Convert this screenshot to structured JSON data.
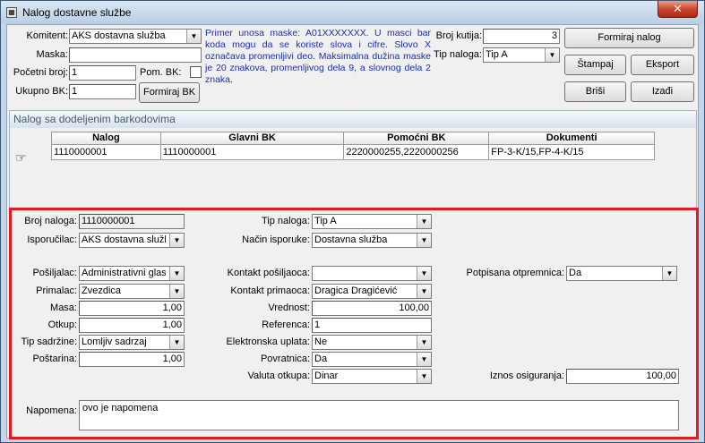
{
  "window": {
    "title": "Nalog dostavne službe",
    "close_glyph": "✕"
  },
  "header": {
    "komitent_label": "Komitent:",
    "komitent_value": "AKS dostavna služba",
    "maska_label": "Maska:",
    "maska_value": "",
    "pocetni_label": "Početni broj:",
    "pocetni_value": "1",
    "pom_bk_label": "Pom. BK:",
    "ukupno_label": "Ukupno BK:",
    "ukupno_value": "1",
    "formiraj_bk_label": "Formiraj BK",
    "mask_hint": "Primer unosa maske: A01XXXXXXX. U masci bar koda mogu da se koriste slova i cifre. Slovo X označava promenljivi deo. Maksimalna dužina maske je 20 znakova, promenljivog dela 9, a slovnog dela 2 znaka.",
    "broj_kutija_label": "Broj kutija:",
    "broj_kutija_value": "3",
    "tip_naloga_label": "Tip naloga:",
    "tip_naloga_value": "Tip A",
    "formiraj_nalog_label": "Formiraj nalog",
    "stampaj_label": "Štampaj",
    "eksport_label": "Eksport",
    "brisi_label": "Briši",
    "izadji_label": "Izađi"
  },
  "group": {
    "title": "Nalog sa dodeljenim barkodovima",
    "columns": [
      "Nalog",
      "Glavni BK",
      "Pomoćni BK",
      "Dokumenti"
    ],
    "rows": [
      [
        "1110000001",
        "1110000001",
        "2220000255,2220000256",
        "FP-3-K/15,FP-4-K/15"
      ]
    ],
    "row_pointer_icon": "hand-pointer-icon"
  },
  "detail": {
    "broj_naloga_label": "Broj naloga:",
    "broj_naloga_value": "1110000001",
    "isporucilac_label": "Isporučilac:",
    "isporucilac_value": "AKS dostavna služb",
    "tip_naloga_label": "Tip naloga:",
    "tip_naloga_value": "Tip A",
    "nacin_label": "Način isporuke:",
    "nacin_value": "Dostavna služba",
    "posiljalac_label": "Pošiljalac:",
    "posiljalac_value": "Administrativni glas",
    "primalac_label": "Primalac:",
    "primalac_value": "Zvezdica",
    "masa_label": "Masa:",
    "masa_value": "1,00",
    "otkup_label": "Otkup:",
    "otkup_value": "1,00",
    "tip_sadrzine_label": "Tip sadržine:",
    "tip_sadrzine_value": "Lomljiv sadrzaj",
    "postarina_label": "Poštarina:",
    "postarina_value": "1,00",
    "kontakt_pos_label": "Kontakt pošiljaoca:",
    "kontakt_pos_value": "",
    "kontakt_prim_label": "Kontakt primaoca:",
    "kontakt_prim_value": "Dragica Dragićević",
    "vrednost_label": "Vrednost:",
    "vrednost_value": "100,00",
    "referenca_label": "Referenca:",
    "referenca_value": "1",
    "el_uplata_label": "Elektronska uplata:",
    "el_uplata_value": "Ne",
    "povratnica_label": "Povratnica:",
    "povratnica_value": "Da",
    "valuta_label": "Valuta otkupa:",
    "valuta_value": "Dinar",
    "otpremnica_label": "Potpisana otpremnica:",
    "otpremnica_value": "Da",
    "osiguranje_label": "Iznos osiguranja:",
    "osiguranje_value": "100,00",
    "napomena_label": "Napomena:",
    "napomena_value": "ovo je napomena"
  },
  "colors": {
    "highlight_border": "#e01b24",
    "hint_text": "#1a2fa8"
  }
}
